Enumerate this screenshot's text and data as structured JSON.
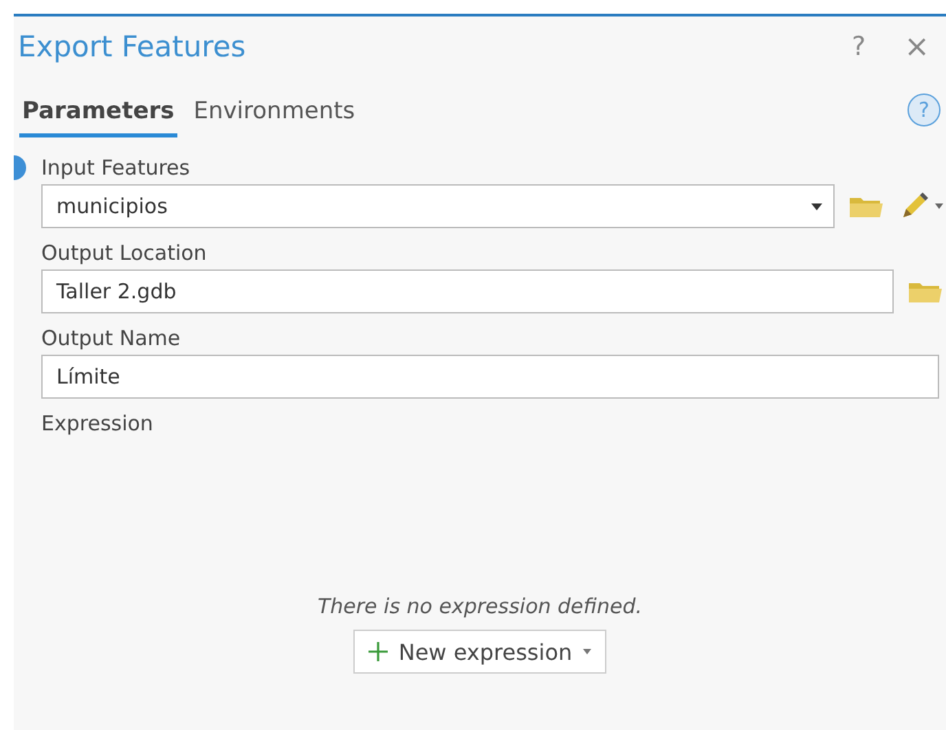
{
  "window": {
    "title": "Export Features",
    "help": "?",
    "close": "×"
  },
  "tabs": [
    {
      "label": "Parameters",
      "selected": true
    },
    {
      "label": "Environments",
      "selected": false
    }
  ],
  "help_icon": "?",
  "parameters": [
    {
      "kind": "dropdown",
      "label": "Input Features",
      "value": "municipios",
      "info": true,
      "browse": true,
      "edit": true
    },
    {
      "kind": "text",
      "label": "Output Location",
      "value": "Taller 2.gdb",
      "info": false,
      "browse": true,
      "edit": false
    },
    {
      "kind": "text",
      "label": "Output Name",
      "value": "Límite",
      "info": false,
      "browse": false,
      "edit": false
    }
  ],
  "expression": {
    "label": "Expression",
    "message": "There is no expression defined.",
    "button": "New expression"
  }
}
